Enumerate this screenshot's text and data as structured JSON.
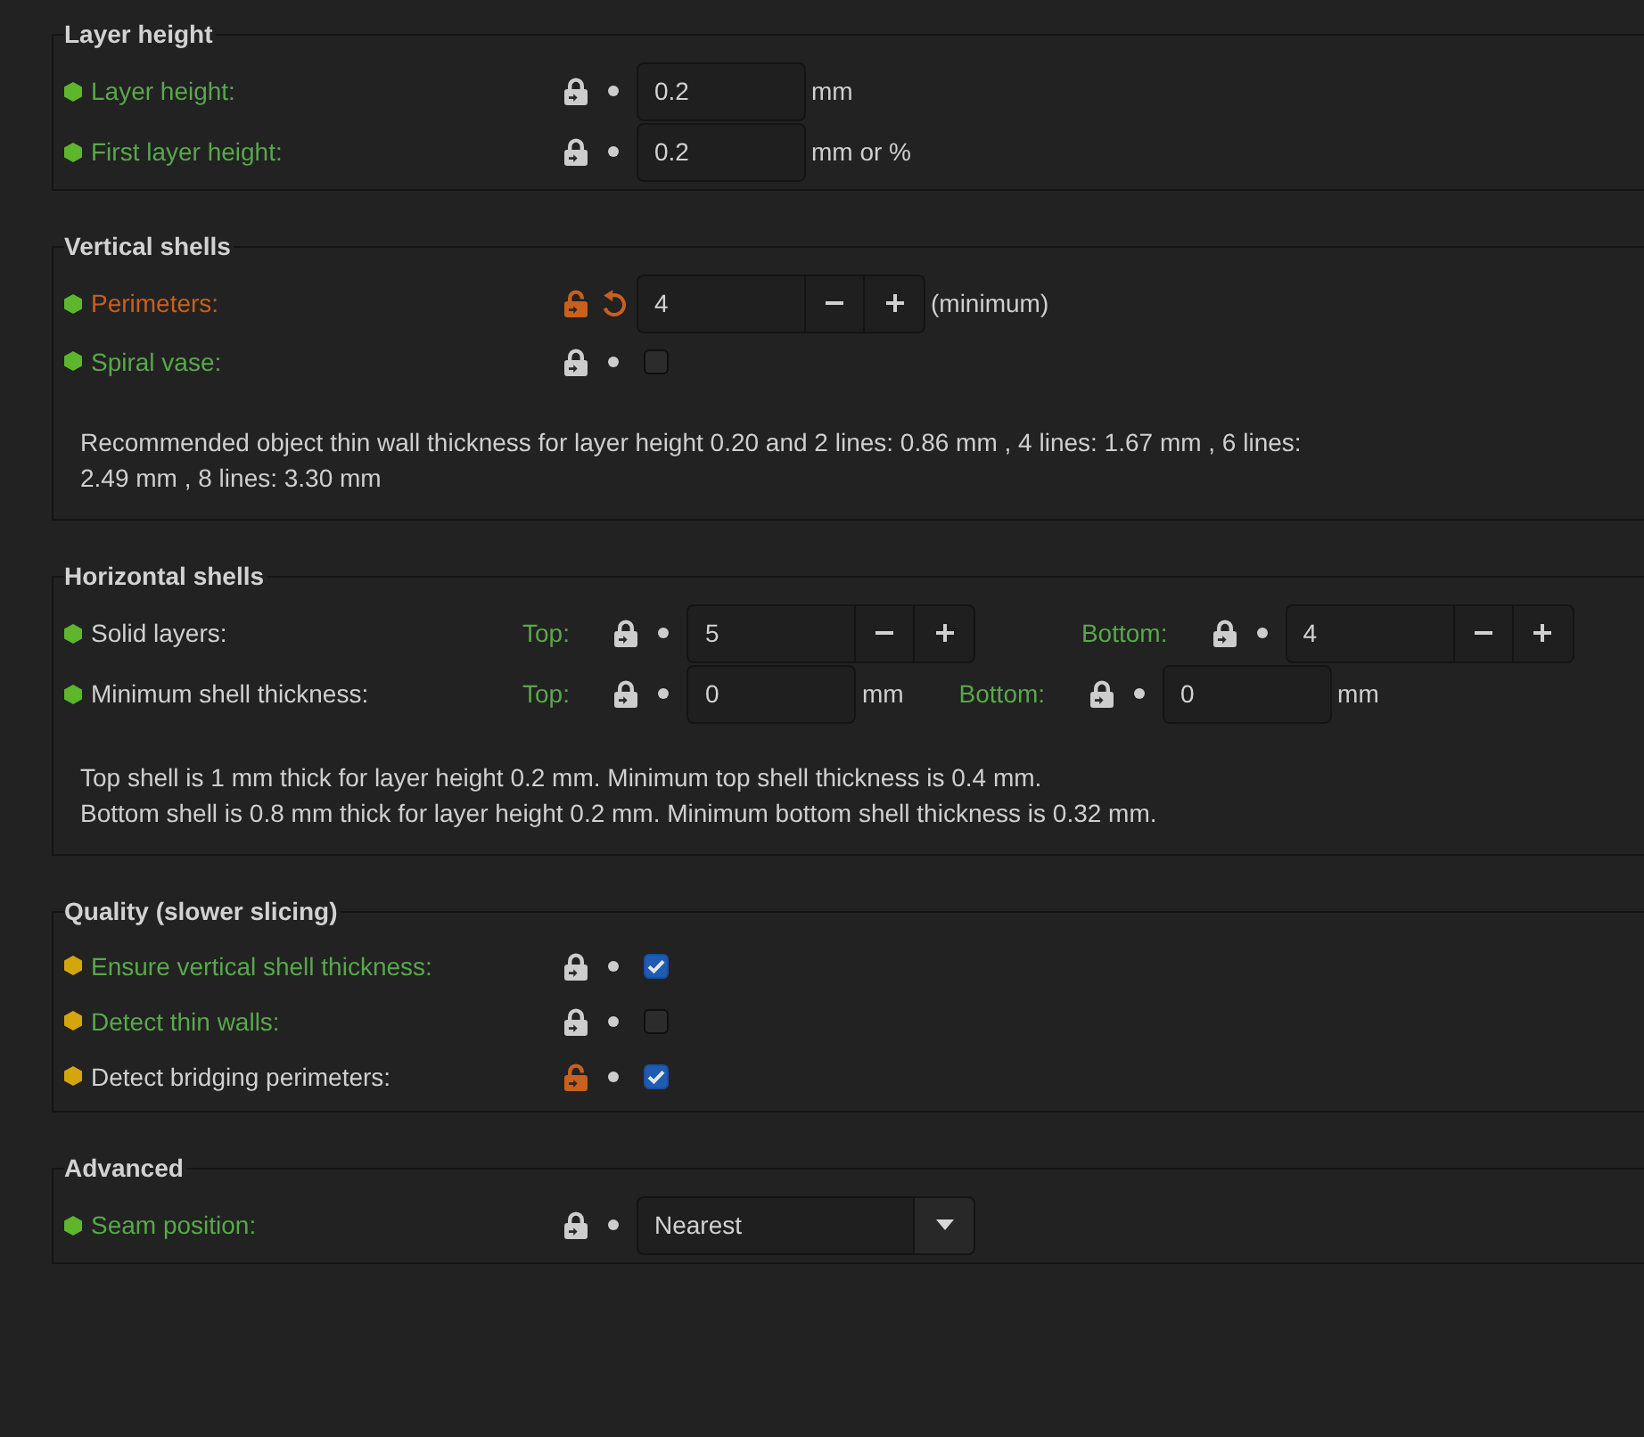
{
  "sections": [
    {
      "title": "Layer height",
      "rows": [
        {
          "kind": "number",
          "label": "Layer height:",
          "color": "#5db62b",
          "system_value": true,
          "modified": false,
          "value": "0.2",
          "unit": "mm"
        },
        {
          "kind": "number",
          "label": "First layer height:",
          "color": "#5db62b",
          "system_value": true,
          "modified": false,
          "value": "0.2",
          "unit": "mm or %"
        }
      ]
    },
    {
      "title": "Vertical shells",
      "rows": [
        {
          "kind": "spin",
          "label": "Perimeters:",
          "color": "#5db62b",
          "system_value": false,
          "modified": true,
          "value": "4",
          "unit": "(minimum)"
        },
        {
          "kind": "checkbox",
          "label": "Spiral vase:",
          "color": "#5db62b",
          "system_value": true,
          "modified": false,
          "checked": false
        }
      ],
      "note": [
        "Recommended object thin wall thickness for layer height 0.20 and 2 lines: 0.86 mm , 4 lines: 1.67 mm , 6 lines: 2.49 mm , 8 lines: 3.30 mm"
      ]
    },
    {
      "title": "Horizontal shells",
      "rows": [
        {
          "kind": "multi",
          "label": "Solid layers:",
          "color": "#5db62b",
          "options": [
            {
              "kind": "spin",
              "label": "Top:",
              "system_value": true,
              "modified": false,
              "value": "5"
            },
            {
              "kind": "spin",
              "label": "Bottom:",
              "system_value": true,
              "modified": false,
              "value": "4"
            }
          ]
        },
        {
          "kind": "multi",
          "label": "Minimum shell thickness:",
          "color": "#5db62b",
          "options": [
            {
              "kind": "number",
              "label": "Top:",
              "system_value": true,
              "modified": false,
              "value": "0",
              "unit": "mm"
            },
            {
              "kind": "number",
              "label": "Bottom:",
              "system_value": true,
              "modified": false,
              "value": "0",
              "unit": "mm"
            }
          ]
        }
      ],
      "note": [
        "Top shell is 1 mm thick for layer height 0.2 mm. Minimum top shell thickness is 0.4 mm.",
        "Bottom shell is 0.8 mm thick for layer height 0.2 mm. Minimum bottom shell thickness is 0.32 mm."
      ]
    },
    {
      "title": "Quality (slower slicing)",
      "rows": [
        {
          "kind": "checkbox",
          "label": "Ensure vertical shell thickness:",
          "color": "#d4a50c",
          "system_value": true,
          "modified": false,
          "checked": true
        },
        {
          "kind": "checkbox",
          "label": "Detect thin walls:",
          "color": "#d4a50c",
          "system_value": true,
          "modified": false,
          "checked": false
        },
        {
          "kind": "checkbox",
          "label": "Detect bridging perimeters:",
          "color": "#d4a50c",
          "system_value": false,
          "modified": false,
          "checked": true
        }
      ]
    },
    {
      "title": "Advanced",
      "rows": [
        {
          "kind": "select",
          "label": "Seam position:",
          "color": "#5db62b",
          "system_value": true,
          "modified": false,
          "value": "Nearest"
        }
      ]
    }
  ]
}
